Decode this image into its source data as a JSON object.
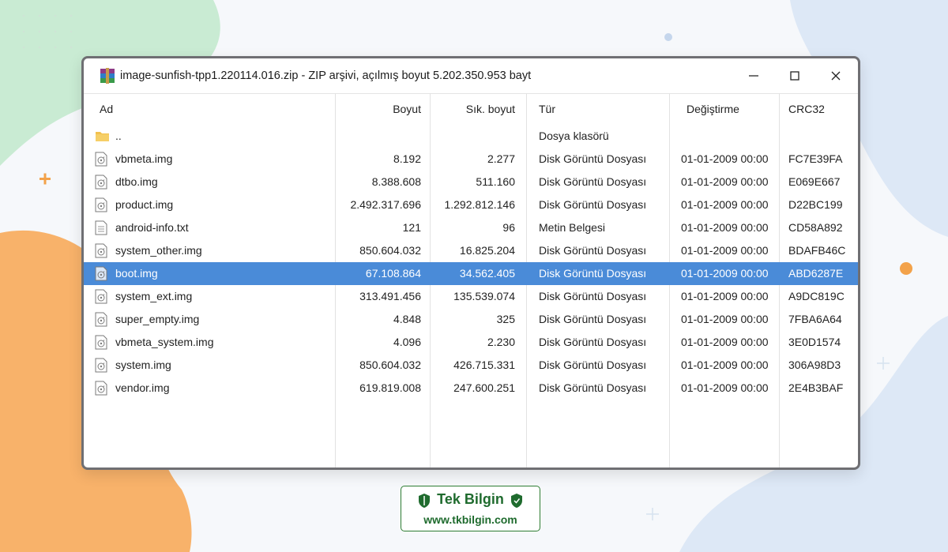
{
  "window": {
    "title": "image-sunfish-tpp1.220114.016.zip - ZIP arşivi, açılmış boyut 5.202.350.953 bayt"
  },
  "columns": {
    "name": "Ad",
    "size": "Boyut",
    "packed": "Sık. boyut",
    "type": "Tür",
    "modified": "Değiştirme",
    "crc": "CRC32"
  },
  "parent_row": {
    "name": "..",
    "type": "Dosya klasörü"
  },
  "files": [
    {
      "name": "vbmeta.img",
      "size": "8.192",
      "packed": "2.277",
      "type": "Disk Görüntü Dosyası",
      "modified": "01-01-2009 00:00",
      "crc": "FC7E39FA",
      "icon": "disk-image-icon"
    },
    {
      "name": "dtbo.img",
      "size": "8.388.608",
      "packed": "511.160",
      "type": "Disk Görüntü Dosyası",
      "modified": "01-01-2009 00:00",
      "crc": "E069E667",
      "icon": "disk-image-icon"
    },
    {
      "name": "product.img",
      "size": "2.492.317.696",
      "packed": "1.292.812.146",
      "type": "Disk Görüntü Dosyası",
      "modified": "01-01-2009 00:00",
      "crc": "D22BC199",
      "icon": "disk-image-icon"
    },
    {
      "name": "android-info.txt",
      "size": "121",
      "packed": "96",
      "type": "Metin Belgesi",
      "modified": "01-01-2009 00:00",
      "crc": "CD58A892",
      "icon": "text-file-icon"
    },
    {
      "name": "system_other.img",
      "size": "850.604.032",
      "packed": "16.825.204",
      "type": "Disk Görüntü Dosyası",
      "modified": "01-01-2009 00:00",
      "crc": "BDAFB46C",
      "icon": "disk-image-icon"
    },
    {
      "name": "boot.img",
      "size": "67.108.864",
      "packed": "34.562.405",
      "type": "Disk Görüntü Dosyası",
      "modified": "01-01-2009 00:00",
      "crc": "ABD6287E",
      "icon": "disk-image-icon",
      "selected": true
    },
    {
      "name": "system_ext.img",
      "size": "313.491.456",
      "packed": "135.539.074",
      "type": "Disk Görüntü Dosyası",
      "modified": "01-01-2009 00:00",
      "crc": "A9DC819C",
      "icon": "disk-image-icon"
    },
    {
      "name": "super_empty.img",
      "size": "4.848",
      "packed": "325",
      "type": "Disk Görüntü Dosyası",
      "modified": "01-01-2009 00:00",
      "crc": "7FBA6A64",
      "icon": "disk-image-icon"
    },
    {
      "name": "vbmeta_system.img",
      "size": "4.096",
      "packed": "2.230",
      "type": "Disk Görüntü Dosyası",
      "modified": "01-01-2009 00:00",
      "crc": "3E0D1574",
      "icon": "disk-image-icon"
    },
    {
      "name": "system.img",
      "size": "850.604.032",
      "packed": "426.715.331",
      "type": "Disk Görüntü Dosyası",
      "modified": "01-01-2009 00:00",
      "crc": "306A98D3",
      "icon": "disk-image-icon"
    },
    {
      "name": "vendor.img",
      "size": "619.819.008",
      "packed": "247.600.251",
      "type": "Disk Görüntü Dosyası",
      "modified": "01-01-2009 00:00",
      "crc": "2E4B3BAF",
      "icon": "disk-image-icon"
    }
  ],
  "footer": {
    "brand": "Tek Bilgin",
    "url": "www.tkbilgin.com"
  },
  "colors": {
    "selection": "#4a8bd8",
    "brand_green": "#1f6b2e",
    "folder": "#f2c14e"
  }
}
